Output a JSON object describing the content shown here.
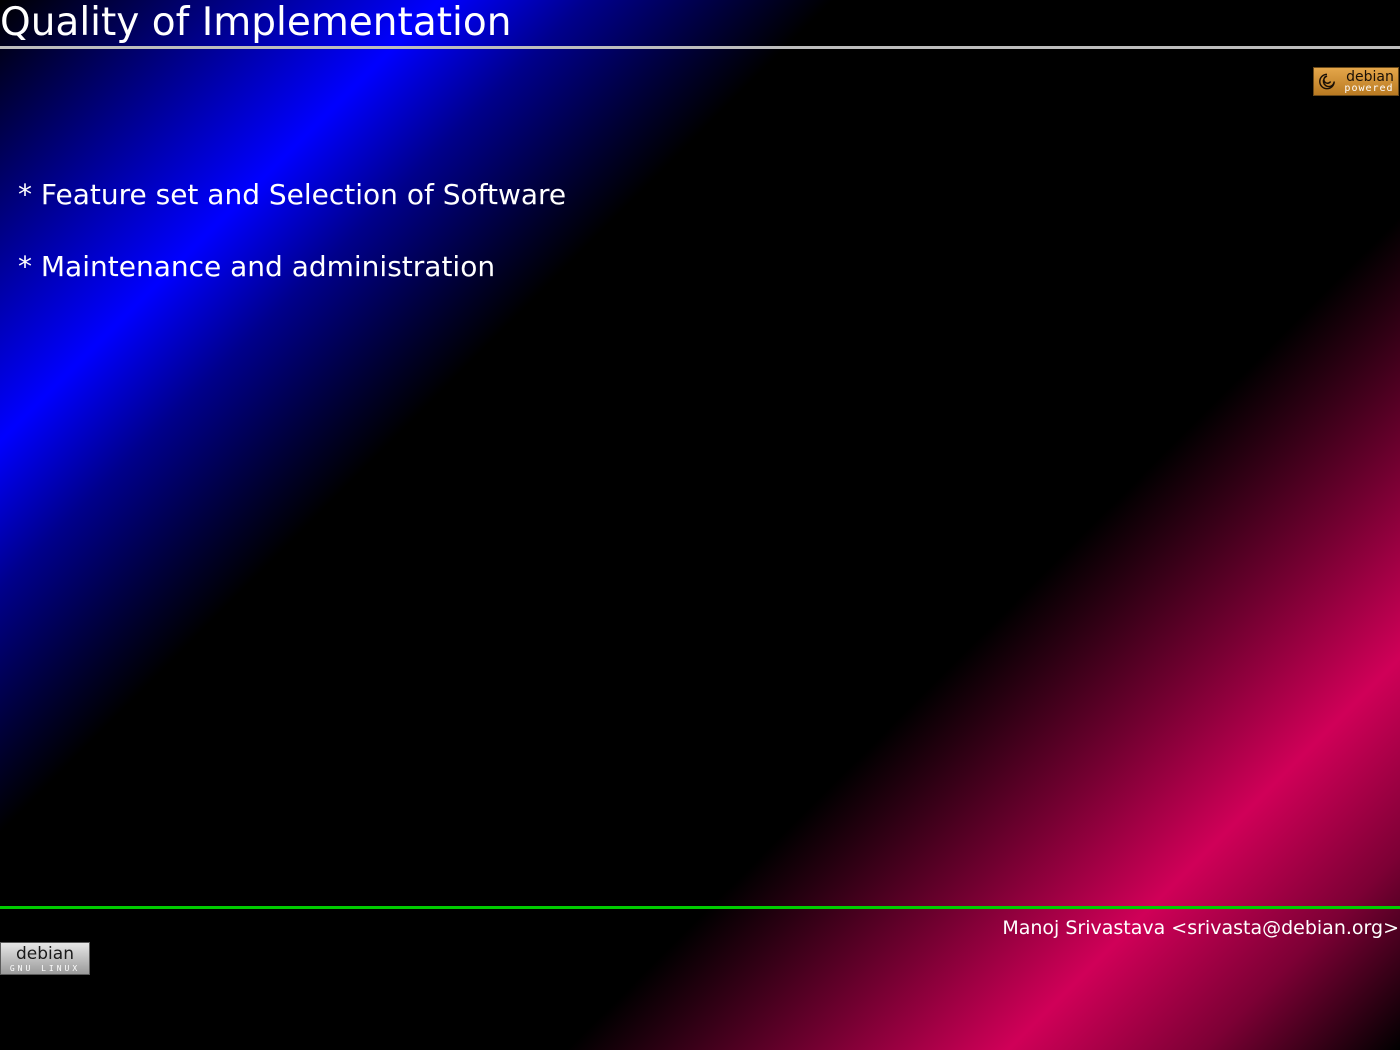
{
  "slide": {
    "title": "Quality of Implementation",
    "bullets": [
      "* Feature set and Selection of Software",
      "* Maintenance and administration"
    ],
    "author": "Manoj Srivastava <srivasta@debian.org>"
  },
  "badges": {
    "top_right": {
      "line1": "debian",
      "line2": "powered"
    },
    "bottom_left": {
      "line1": "debian",
      "line2": "GNU LINUX"
    }
  },
  "colors": {
    "background": "#000000",
    "blue_glow": "#0000ff",
    "red_glow": "#d00058",
    "title_rule": "#bdbdbd",
    "footer_rule": "#00cc00",
    "text": "#ffffff"
  }
}
